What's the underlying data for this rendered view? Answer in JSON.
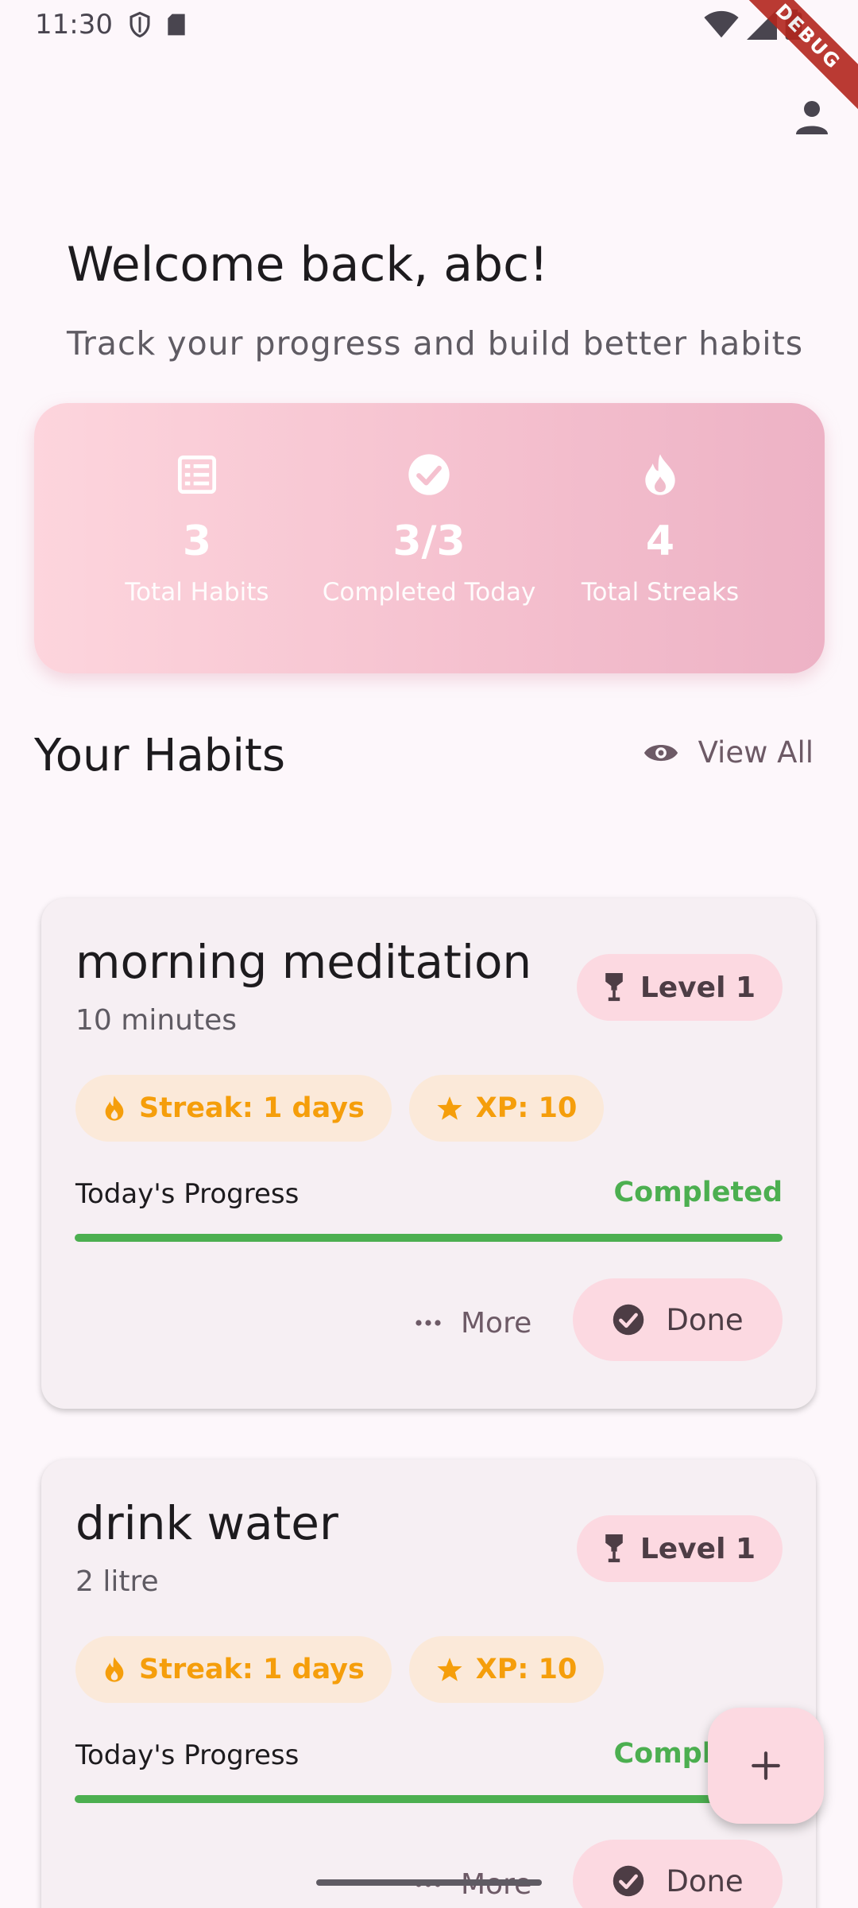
{
  "status_bar": {
    "time": "11:30",
    "debug_label": "DEBUG"
  },
  "header": {
    "welcome": "Welcome back, abc!",
    "subtitle": "Track your progress and build better habits"
  },
  "stats": [
    {
      "icon": "list-icon",
      "value": "3",
      "label": "Total Habits"
    },
    {
      "icon": "check-circle-icon",
      "value": "3/3",
      "label": "Completed Today"
    },
    {
      "icon": "flame-icon",
      "value": "4",
      "label": "Total Streaks"
    }
  ],
  "habits_section": {
    "title": "Your Habits",
    "view_all": "View All"
  },
  "habits": [
    {
      "name": "morning meditation",
      "goal": "10 minutes",
      "level": "Level 1",
      "streak": "Streak: 1 days",
      "xp": "XP: 10",
      "progress_label": "Today's Progress",
      "progress_status": "Completed",
      "progress": 1.0,
      "more": "More",
      "done": "Done"
    },
    {
      "name": "drink water",
      "goal": "2 litre",
      "level": "Level 1",
      "streak": "Streak: 1 days",
      "xp": "XP: 10",
      "progress_label": "Today's Progress",
      "progress_status": "Completed",
      "progress": 1.0,
      "more": "More",
      "done": "Done"
    }
  ],
  "colors": {
    "accent_pink": "#fcd9e1",
    "success_green": "#4caf50",
    "streak_orange": "#f59e0b",
    "background": "#fdf7fb"
  }
}
